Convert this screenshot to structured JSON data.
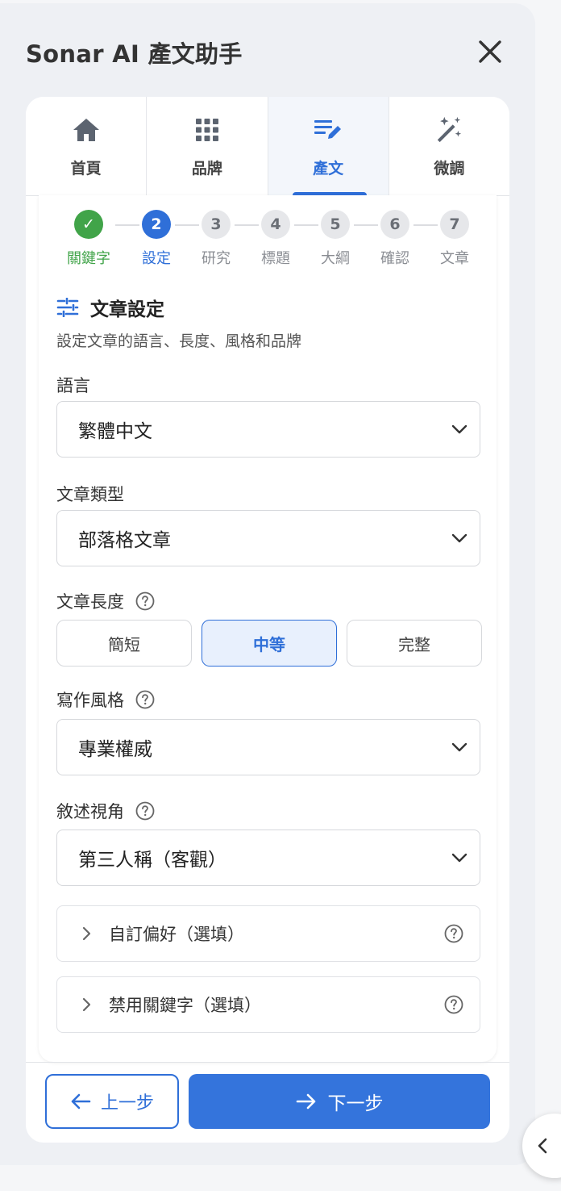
{
  "header": {
    "title": "Sonar AI 產文助手"
  },
  "tabs": [
    {
      "label": "首頁",
      "icon": "home-icon"
    },
    {
      "label": "品牌",
      "icon": "grid-icon"
    },
    {
      "label": "產文",
      "icon": "write-icon"
    },
    {
      "label": "微調",
      "icon": "magic-wand-icon"
    }
  ],
  "active_tab": "產文",
  "steps": [
    {
      "num": "✓",
      "label": "關鍵字",
      "state": "done"
    },
    {
      "num": "2",
      "label": "設定",
      "state": "current"
    },
    {
      "num": "3",
      "label": "研究",
      "state": "pending"
    },
    {
      "num": "4",
      "label": "標題",
      "state": "pending"
    },
    {
      "num": "5",
      "label": "大綱",
      "state": "pending"
    },
    {
      "num": "6",
      "label": "確認",
      "state": "pending"
    },
    {
      "num": "7",
      "label": "文章",
      "state": "pending"
    }
  ],
  "section": {
    "title": "文章設定",
    "description": "設定文章的語言、長度、風格和品牌"
  },
  "fields": {
    "language": {
      "label": "語言",
      "value": "繁體中文"
    },
    "type": {
      "label": "文章類型",
      "value": "部落格文章"
    },
    "length": {
      "label": "文章長度",
      "options": [
        "簡短",
        "中等",
        "完整"
      ],
      "selected": "中等"
    },
    "style": {
      "label": "寫作風格",
      "value": "專業權威"
    },
    "perspective": {
      "label": "敘述視角",
      "value": "第三人稱（客觀）"
    }
  },
  "collapsibles": {
    "preferences": "自訂偏好（選填）",
    "banned": "禁用關鍵字（選填）"
  },
  "footer": {
    "back": "上一步",
    "next": "下一步"
  },
  "colors": {
    "primary": "#2f6fd8",
    "success": "#41a449"
  }
}
